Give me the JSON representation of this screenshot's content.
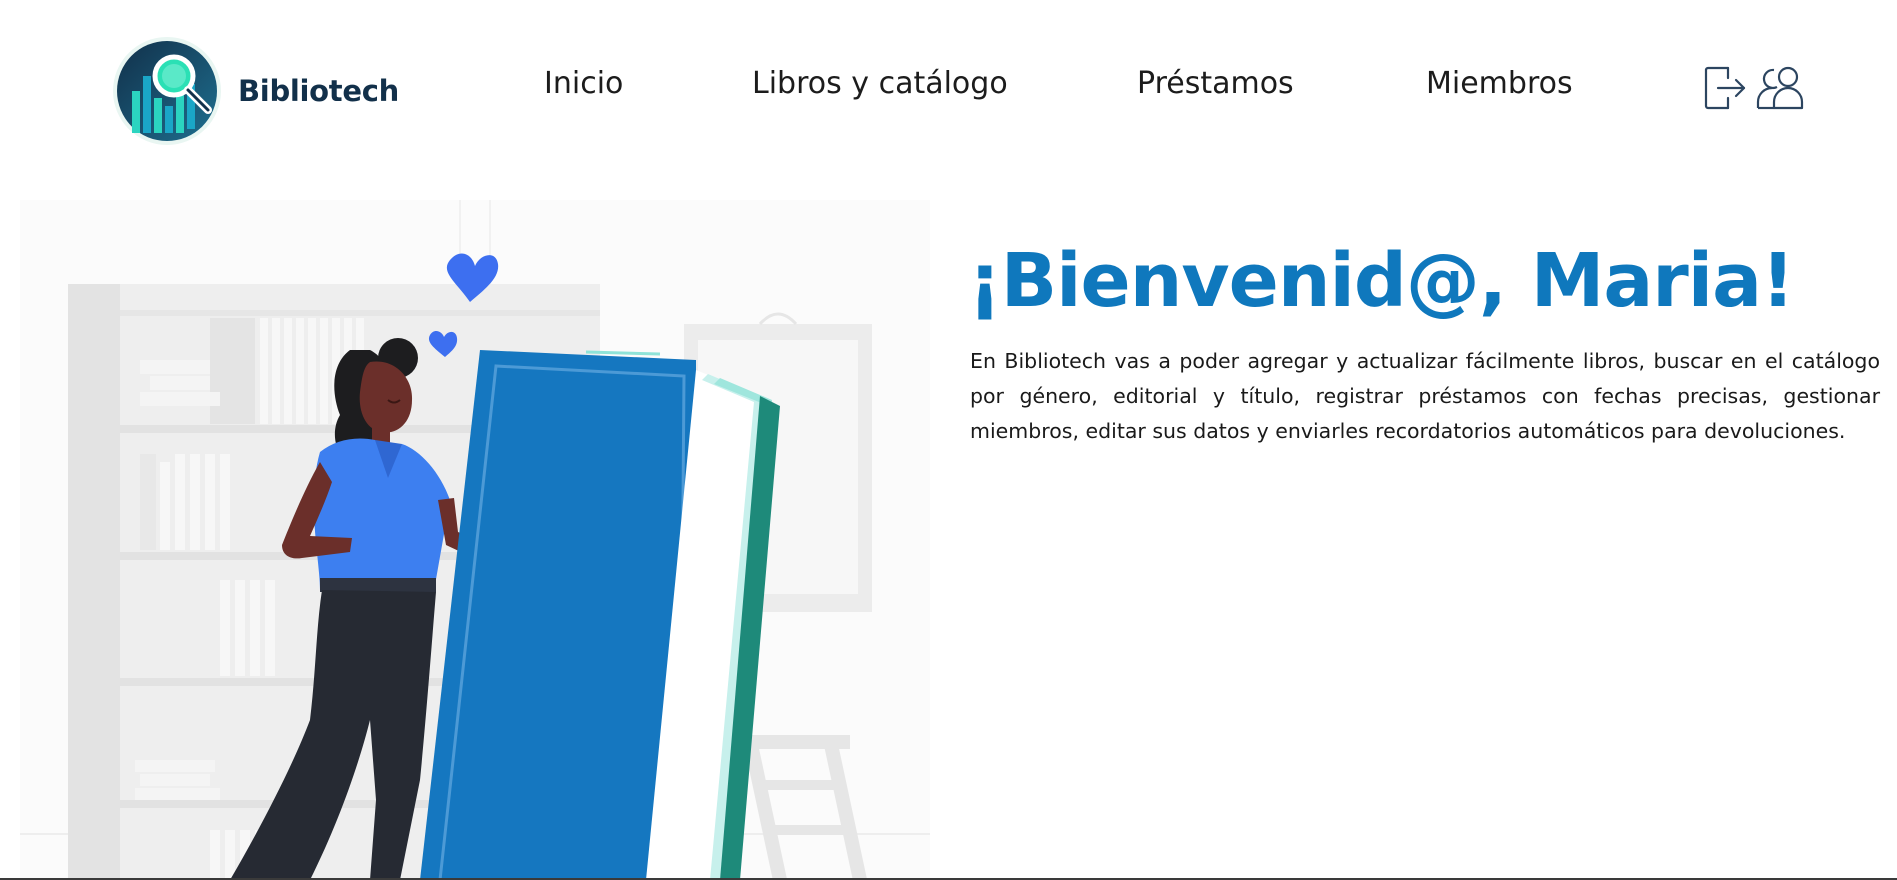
{
  "header": {
    "brand_name": "Bibliotech",
    "logo_icon": "library-search-logo-icon",
    "nav": [
      {
        "label": "Inicio"
      },
      {
        "label": "Libros y catálogo"
      },
      {
        "label": "Préstamos"
      },
      {
        "label": "Miembros"
      }
    ],
    "actions": [
      {
        "icon": "logout-icon"
      },
      {
        "icon": "members-icon"
      }
    ]
  },
  "main": {
    "title": "¡Bienvenid@, Maria!",
    "description": "En Bibliotech vas a poder agregar y actualizar fácilmente libros, buscar en el catálogo por género, editorial y título, registrar préstamos con fechas precisas, gestionar miembros, editar sus datos y enviarles recordatorios automáticos para devoluciones."
  },
  "colors": {
    "accent": "#0f78bd",
    "brand_dark": "#12304a",
    "book_blue": "#1577c0",
    "person_shirt": "#3d7ff0",
    "heart": "#3d6ff0",
    "teal": "#1e8a7a"
  }
}
